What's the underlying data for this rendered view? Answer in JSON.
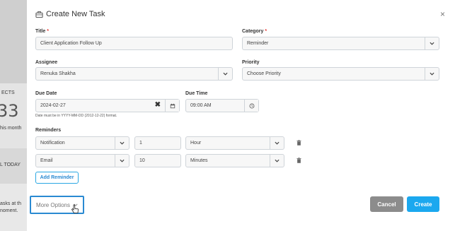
{
  "background": {
    "texts": [
      "ECTS",
      "33",
      "his month",
      "L TODAY",
      "asks at th",
      "noment."
    ]
  },
  "modal": {
    "title": "Create New Task",
    "close_icon": "×",
    "title_field": {
      "label": "Title",
      "required_mark": "*",
      "value": "Client Application Follow Up"
    },
    "category": {
      "label": "Category",
      "required_mark": "*",
      "value": "Reminder"
    },
    "assignee": {
      "label": "Assignee",
      "value": "Renuka Shakha"
    },
    "priority": {
      "label": "Priority",
      "value": "Choose Priority"
    },
    "due_date": {
      "label": "Due Date",
      "value": "2024-02-27",
      "hint": "Date must be in YYYY-MM-DD (2012-12-22) format."
    },
    "due_time": {
      "label": "Due Time",
      "value": "09:00 AM"
    },
    "reminders": {
      "label": "Reminders",
      "rows": [
        {
          "method": "Notification",
          "amount": "1",
          "unit": "Hour"
        },
        {
          "method": "Email",
          "amount": "10",
          "unit": "Minutes"
        }
      ],
      "add_label": "Add Reminder"
    },
    "more_options_label": "More Options",
    "cancel_label": "Cancel",
    "create_label": "Create"
  },
  "colors": {
    "accent": "#1ba8ef",
    "cancel": "#8c8c8c",
    "required": "#e53935"
  }
}
